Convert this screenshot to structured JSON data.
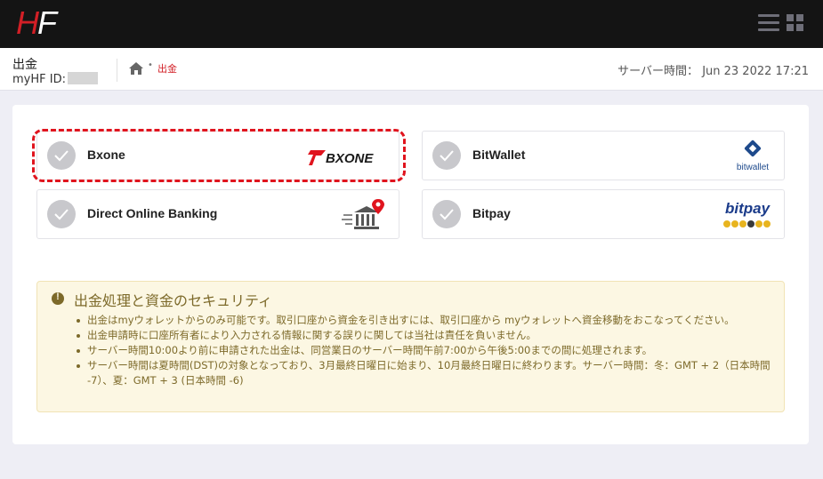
{
  "app": {
    "logo_h": "H",
    "logo_f": "F",
    "menu_icon": "hamburger-icon",
    "apps_icon": "grid-icon"
  },
  "header": {
    "title": "出金",
    "myhf_label": "myHF ID:",
    "breadcrumb_sep": "•",
    "breadcrumb_current": "出金",
    "home_icon": "home-icon",
    "server_time_label": "サーバー時間：",
    "server_time_value": "Jun 23 2022 17:21"
  },
  "methods": [
    {
      "name": "Bxone",
      "logo_text": "BXONE",
      "selected": true
    },
    {
      "name": "BitWallet",
      "logo_text": "bitwallet",
      "selected": false
    },
    {
      "name": "Direct Online Banking",
      "logo_icon": "bank-icon",
      "selected": false
    },
    {
      "name": "Bitpay",
      "logo_text": "bitpay",
      "selected": false
    }
  ],
  "notice": {
    "title": "出金処理と資金のセキュリティ",
    "icon": "alert-icon",
    "items": [
      "出金はmyウォレットからのみ可能です。取引口座から資金を引き出すには、取引口座から myウォレットへ資金移動をおこなってください。",
      "出金申請時に口座所有者により入力される情報に関する誤りに関しては当社は責任を負いません。",
      "サーバー時間10:00より前に申請された出金は、同営業日のサーバー時間午前7:00から午後5:00までの間に処理されます。",
      "サーバー時間は夏時間(DST)の対象となっており、3月最終日曜日に始まり、10月最終日曜日に終わります。サーバー時間：冬：GMT + 2（日本時間 -7）、夏：GMT + 3 (日本時間 -6)"
    ]
  },
  "colors": {
    "brand_red": "#d21f26",
    "notice_bg": "#fcf7e3",
    "notice_text": "#7d6a2a"
  }
}
